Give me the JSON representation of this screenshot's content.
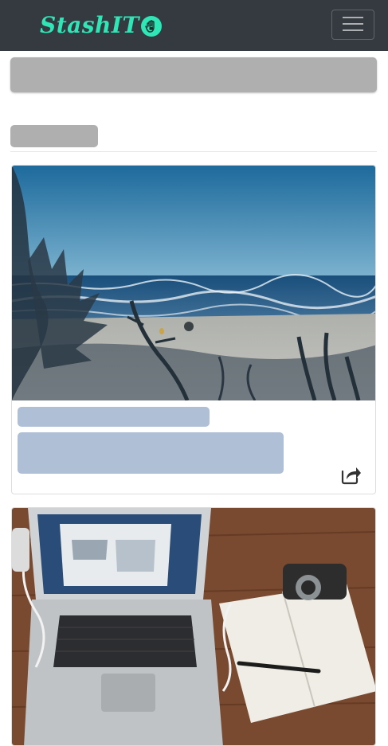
{
  "navbar": {
    "brand_text": "StashIT",
    "brand_icon": "hand-lock-icon",
    "menu_icon": "hamburger-icon",
    "colors": {
      "background": "#343a40",
      "brand": "#2ee6b6"
    }
  },
  "loading_placeholders": {
    "skeleton_color": "#afafaf",
    "card_skeleton_color": "#aebfd6"
  },
  "cards": [
    {
      "image": "beach-ocean-photo",
      "share_icon": "share-icon"
    },
    {
      "image": "laptop-desk-photo"
    }
  ]
}
